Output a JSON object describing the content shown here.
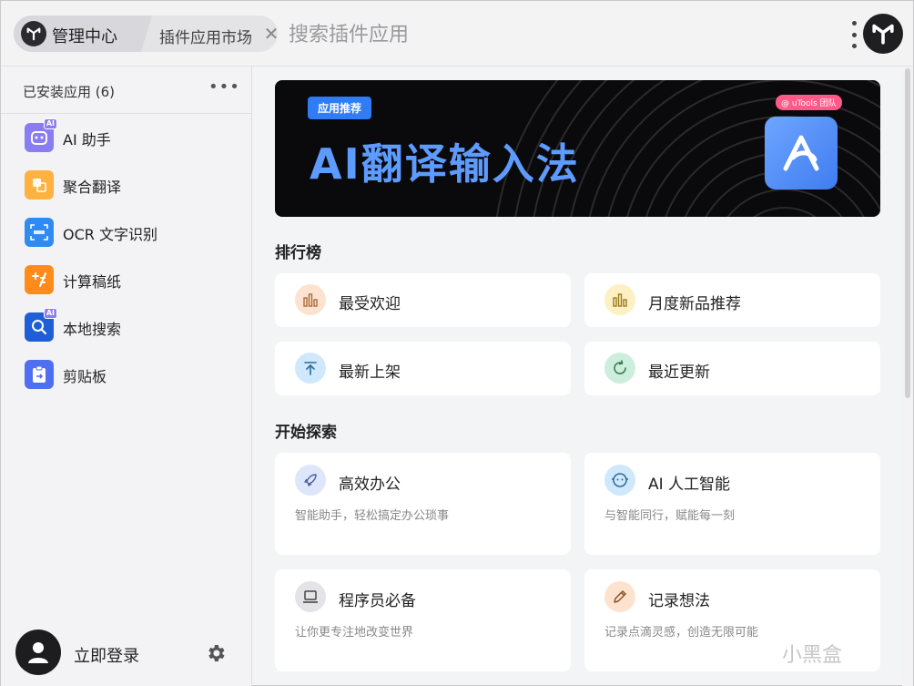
{
  "header": {
    "home_label": "管理中心",
    "market_label": "插件应用市场",
    "close_glyph": "✕",
    "search_placeholder": "搜索插件应用"
  },
  "sidebar": {
    "title": "已安装应用 (6)",
    "more": "•••",
    "items": [
      {
        "label": "AI 助手",
        "icon": "robot-icon",
        "color": "#8a7cf3",
        "badge": "AI"
      },
      {
        "label": "聚合翻译",
        "icon": "translate-icon",
        "color": "#ffb23f",
        "badge": ""
      },
      {
        "label": "OCR 文字识别",
        "icon": "ocr-icon",
        "color": "#2f8bf1",
        "badge": ""
      },
      {
        "label": "计算稿纸",
        "icon": "calculator-icon",
        "color": "#ff8c1a",
        "badge": ""
      },
      {
        "label": "本地搜索",
        "icon": "local-search-icon",
        "color": "#1e5fd6",
        "badge": "AI"
      },
      {
        "label": "剪贴板",
        "icon": "clipboard-icon",
        "color": "#4f6ef2",
        "badge": ""
      }
    ],
    "login_label": "立即登录"
  },
  "main": {
    "banner": {
      "tag": "应用推荐",
      "title": "AI翻译输入法",
      "bubble": "@ uTools 团队"
    },
    "ranking_title": "排行榜",
    "ranking": [
      {
        "label": "最受欢迎",
        "icon": "bar-chart-icon",
        "bg": "#fde3cf"
      },
      {
        "label": "月度新品推荐",
        "icon": "bar-chart-icon",
        "bg": "#fdf0c2"
      },
      {
        "label": "最新上架",
        "icon": "upload-icon",
        "bg": "#cfe8fb"
      },
      {
        "label": "最近更新",
        "icon": "refresh-icon",
        "bg": "#cdeedd"
      }
    ],
    "explore_title": "开始探索",
    "explore": [
      {
        "label": "高效办公",
        "desc": "智能助手，轻松搞定办公琐事",
        "icon": "rocket-icon",
        "bg": "#dde6fb"
      },
      {
        "label": "AI 人工智能",
        "desc": "与智能同行，赋能每一刻",
        "icon": "ai-face-icon",
        "bg": "#cfe8fb"
      },
      {
        "label": "程序员必备",
        "desc": "让你更专注地改变世界",
        "icon": "laptop-icon",
        "bg": "#e4e4e8"
      },
      {
        "label": "记录想法",
        "desc": "记录点滴灵感，创造无限可能",
        "icon": "pencil-icon",
        "bg": "#fde3cf"
      }
    ]
  },
  "watermark": "小黑盒"
}
